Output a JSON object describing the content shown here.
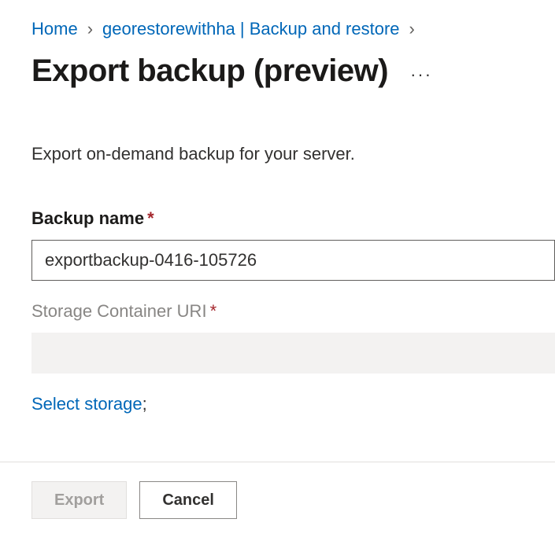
{
  "breadcrumb": {
    "home": "Home",
    "resource": "georestorewithha | Backup and restore"
  },
  "page_title": "Export backup (preview)",
  "description": "Export on-demand backup for your server.",
  "fields": {
    "backup_name": {
      "label": "Backup name",
      "value": "exportbackup-0416-105726"
    },
    "storage_uri": {
      "label": "Storage Container URI",
      "value": ""
    }
  },
  "select_storage_link": "Select storage",
  "select_storage_suffix": ";",
  "buttons": {
    "export": "Export",
    "cancel": "Cancel"
  }
}
